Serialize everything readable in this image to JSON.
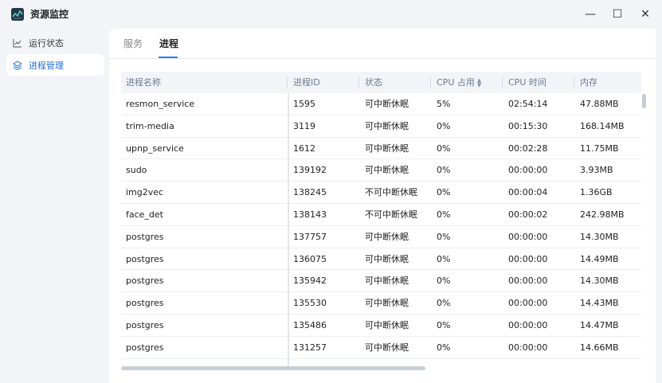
{
  "window": {
    "title": "资源监控",
    "minimize_symbol": "—",
    "maximize_symbol": "☐",
    "close_symbol": "✕"
  },
  "sidebar": {
    "items": [
      {
        "label": "运行状态",
        "icon": "line-chart-icon",
        "active": false
      },
      {
        "label": "进程管理",
        "icon": "layers-icon",
        "active": true
      }
    ]
  },
  "tabs": [
    {
      "label": "服务",
      "active": false
    },
    {
      "label": "进程",
      "active": true
    }
  ],
  "table": {
    "headers": [
      "进程名称",
      "进程ID",
      "状态",
      "CPU 占用",
      "CPU 时间",
      "内存"
    ],
    "sort_column": "CPU 占用",
    "rows": [
      [
        "resmon_service",
        "1595",
        "可中断休眠",
        "5%",
        "02:54:14",
        "47.88MB"
      ],
      [
        "trim-media",
        "3119",
        "可中断休眠",
        "0%",
        "00:15:30",
        "168.14MB"
      ],
      [
        "upnp_service",
        "1612",
        "可中断休眠",
        "0%",
        "00:02:28",
        "11.75MB"
      ],
      [
        "sudo",
        "139192",
        "可中断休眠",
        "0%",
        "00:00:00",
        "3.93MB"
      ],
      [
        "img2vec",
        "138245",
        "不可中断休眠",
        "0%",
        "00:00:04",
        "1.36GB"
      ],
      [
        "face_det",
        "138143",
        "不可中断休眠",
        "0%",
        "00:00:02",
        "242.98MB"
      ],
      [
        "postgres",
        "137757",
        "可中断休眠",
        "0%",
        "00:00:00",
        "14.30MB"
      ],
      [
        "postgres",
        "136075",
        "可中断休眠",
        "0%",
        "00:00:00",
        "14.49MB"
      ],
      [
        "postgres",
        "135942",
        "可中断休眠",
        "0%",
        "00:00:00",
        "14.30MB"
      ],
      [
        "postgres",
        "135530",
        "可中断休眠",
        "0%",
        "00:00:00",
        "14.43MB"
      ],
      [
        "postgres",
        "135486",
        "可中断休眠",
        "0%",
        "00:00:00",
        "14.47MB"
      ],
      [
        "postgres",
        "131257",
        "可中断休眠",
        "0%",
        "00:00:00",
        "14.66MB"
      ]
    ]
  },
  "colors": {
    "accent": "#2a7be4",
    "active_text": "#1f6fd6",
    "header_text": "#6b7a90"
  }
}
